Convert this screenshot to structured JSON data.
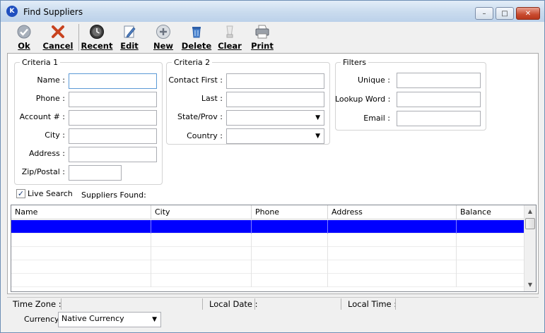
{
  "window": {
    "title": "Find Suppliers",
    "minimize_glyph": "–",
    "maximize_glyph": "□",
    "close_glyph": "✕"
  },
  "toolbar": {
    "buttons": [
      {
        "label": "Ok",
        "icon": "check-icon"
      },
      {
        "label": "Cancel",
        "icon": "cross-icon"
      },
      {
        "label": "Recent",
        "icon": "clock-icon"
      },
      {
        "label": "Edit",
        "icon": "pencil-icon"
      },
      {
        "label": "New",
        "icon": "plus-circle-icon"
      },
      {
        "label": "Delete",
        "icon": "trash-icon"
      },
      {
        "label": "Clear",
        "icon": "eraser-icon"
      },
      {
        "label": "Print",
        "icon": "printer-icon"
      }
    ]
  },
  "criteria1": {
    "legend": "Criteria 1",
    "fields": [
      {
        "label": "Name :",
        "value": ""
      },
      {
        "label": "Phone :",
        "value": ""
      },
      {
        "label": "Account # :",
        "value": ""
      },
      {
        "label": "City :",
        "value": ""
      },
      {
        "label": "Address :",
        "value": ""
      },
      {
        "label": "Zip/Postal :",
        "value": ""
      }
    ]
  },
  "criteria2": {
    "legend": "Criteria 2",
    "fields": [
      {
        "label": "Contact First :",
        "value": ""
      },
      {
        "label": "Last :",
        "value": ""
      },
      {
        "label": "State/Prov :",
        "value": ""
      },
      {
        "label": "Country :",
        "value": ""
      }
    ]
  },
  "filters": {
    "legend": "Filters",
    "fields": [
      {
        "label": "Unique :",
        "value": ""
      },
      {
        "label": "Lookup Word :",
        "value": ""
      },
      {
        "label": "Email :",
        "value": ""
      }
    ]
  },
  "live_search": {
    "label": "Live Search",
    "checked": true,
    "check_glyph": "✓"
  },
  "suppliers_found": {
    "label": "Suppliers Found:"
  },
  "grid": {
    "columns": [
      "Name",
      "City",
      "Phone",
      "Address",
      "Balance"
    ],
    "selected_row": 0,
    "row_count": 5
  },
  "scrollbar": {
    "up_glyph": "▲",
    "down_glyph": "▼"
  },
  "dropdown_glyph": "▼",
  "status": {
    "time_zone_label": "Time Zone :",
    "local_date_label": "Local Date :",
    "local_time_label": "Local Time :"
  },
  "currency": {
    "label": "Currency:",
    "value": "Native Currency"
  }
}
